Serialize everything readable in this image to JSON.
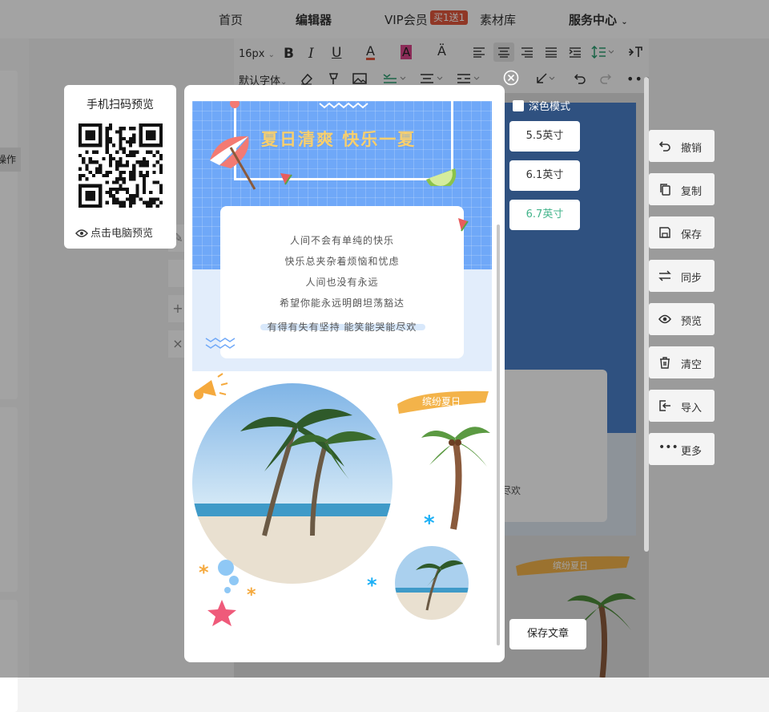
{
  "nav": {
    "home": "首页",
    "editor": "编辑器",
    "vip": "VIP会员",
    "vip_badge": "买1送1",
    "materials": "素材库",
    "service": "服务中心"
  },
  "toolbar": {
    "font_size": "16px",
    "font_family": "默认字体"
  },
  "left_panel": {
    "operation_label": "操作"
  },
  "qr_panel": {
    "title": "手机扫码预览",
    "pc_preview": "点击电脑预览"
  },
  "poster": {
    "headline": "夏日清爽 快乐一夏",
    "lines": [
      "人间不会有单纯的快乐",
      "快乐总夹杂着烦恼和忧虑",
      "人间也没有永远",
      "希望你能永远明朗坦荡豁达",
      "有得有失有坚持 能笑能哭能尽欢"
    ],
    "brush_label": "缤纷夏日"
  },
  "preview_controls": {
    "dark_mode": "深色模式",
    "sizes": [
      "5.5英寸",
      "6.1英寸",
      "6.7英寸"
    ],
    "active_size": "6.7英寸",
    "save": "保存文章"
  },
  "actions": [
    {
      "label": "撤销",
      "icon": "undo-icon"
    },
    {
      "label": "复制",
      "icon": "copy-icon"
    },
    {
      "label": "保存",
      "icon": "save-icon"
    },
    {
      "label": "同步",
      "icon": "sync-icon"
    },
    {
      "label": "预览",
      "icon": "eye-icon"
    },
    {
      "label": "清空",
      "icon": "trash-icon"
    },
    {
      "label": "导入",
      "icon": "import-icon"
    },
    {
      "label": "更多",
      "icon": "more-icon"
    }
  ],
  "background_canvas": {
    "brush_label": "缤纷夏日",
    "snippet": "尽欢"
  },
  "colors": {
    "accent_green": "#43b48b",
    "poster_blue": "#6fa8f8",
    "headline_yellow": "#f8cf6e",
    "badge_red": "#e2573c"
  }
}
